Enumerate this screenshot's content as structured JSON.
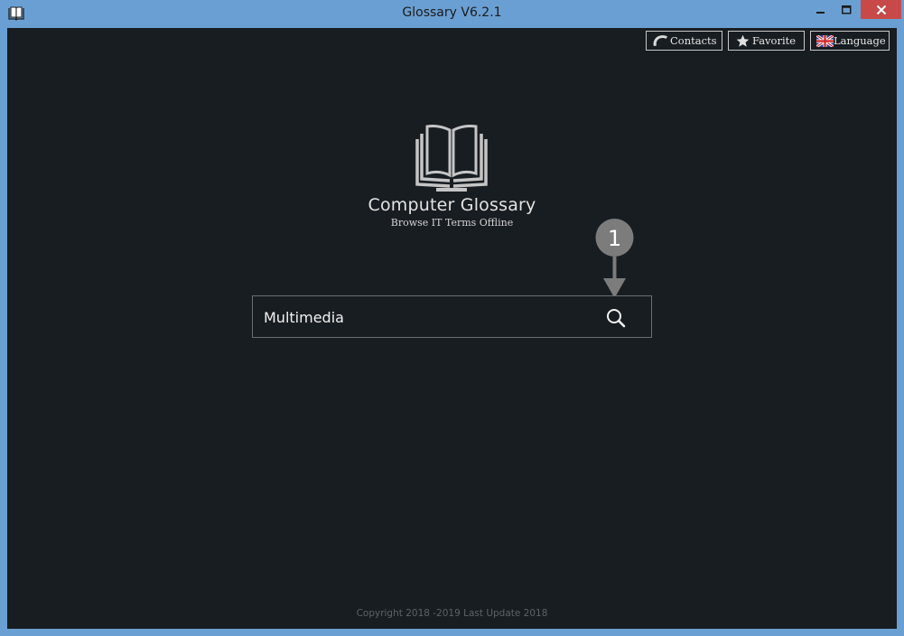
{
  "window": {
    "title": "Glossary V6.2.1",
    "colors": {
      "titlebar": "#6a9fd3",
      "background": "#181d22",
      "close": "#c74a48"
    }
  },
  "titlebar_icons": {
    "app": "book-icon",
    "minimize": "minimize-icon",
    "maximize": "maximize-icon",
    "close": "close-icon"
  },
  "toolbar": {
    "contacts_label": "Contacts",
    "contacts_icon": "phone-icon",
    "favorite_label": "Favorite",
    "favorite_icon": "star-icon",
    "language_label": "Language",
    "language_icon": "uk-flag-icon"
  },
  "hero": {
    "logo_icon": "open-book-icon",
    "app_name": "Computer Glossary",
    "tagline": "Browse IT Terms Offline"
  },
  "search": {
    "value": "Multimedia",
    "button_icon": "search-icon"
  },
  "annotation": {
    "step_number": "1",
    "color": "#7c7c7c"
  },
  "footer": {
    "copyright": "Copyright 2018 -2019 Last Update 2018"
  }
}
